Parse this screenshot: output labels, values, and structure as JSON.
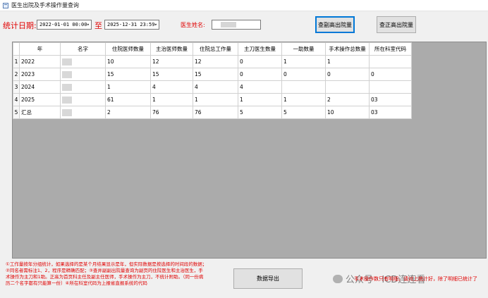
{
  "window": {
    "title": "医生出院及手术操作量查询"
  },
  "filters": {
    "stat_label": "统计日期:",
    "start_datetime": "2022-01-01 00:00",
    "to_label": "至",
    "end_datetime": "2025-12-31 23:59",
    "doctor_label": "医生姓名:",
    "doctor_value": ""
  },
  "buttons": {
    "deputy_label": "查副高出院量",
    "chief_label": "查正高出院量",
    "export_label": "数据导出"
  },
  "table": {
    "headers": [
      "年",
      "名字",
      "住院医师数量",
      "主治医师数量",
      "住院总工作量",
      "主刀医生数量",
      "一助数量",
      "手术操作总数量",
      "所在科室代码"
    ],
    "rows": [
      {
        "num": "1",
        "cells": [
          "2022",
          "",
          "10",
          "12",
          "12",
          "0",
          "1",
          "1",
          ""
        ]
      },
      {
        "num": "2",
        "cells": [
          "2023",
          "",
          "15",
          "15",
          "15",
          "0",
          "0",
          "0",
          "0"
        ]
      },
      {
        "num": "3",
        "cells": [
          "2024",
          "",
          "1",
          "4",
          "4",
          "4",
          "",
          "",
          ""
        ]
      },
      {
        "num": "4",
        "cells": [
          "2025",
          "",
          "61",
          "1",
          "1",
          "1",
          "1",
          "2",
          "03"
        ]
      },
      {
        "num": "5",
        "cells": [
          "汇总",
          "",
          "2",
          "76",
          "76",
          "5",
          "5",
          "10",
          "03"
        ]
      }
    ]
  },
  "notes": "①工作量按年分组统计，如果选择的是某个月结果显示是年，但实际数据是按选择的时间段的数据；②同名者需标注1、2，程序是精确匹配；③查并副副出院量查询为副页的住院医生和主治医生，手术操作为主刀和1助。正高为首页科主任及副主任医师，手术操作为主刀，不统计附助。（同一份病历二个名字都有只能算一份）④所在科室代码为上报省直报系统的代码",
  "watermark": "公众号 · ICD连连看",
  "tip": "手术操作数只有明细，请对上统计好，除了明细已统计了"
}
